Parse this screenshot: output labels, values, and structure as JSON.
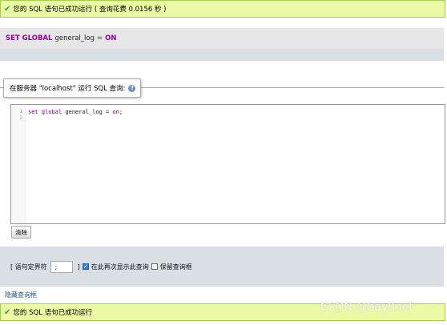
{
  "top_message": {
    "text": "您的 SQL 语句已成功运行 ( 查询花费 0.0156 秒 )",
    "icon": "check-icon"
  },
  "sql_display": {
    "keyword": "SET GLOBAL",
    "variable": "general_log",
    "operator": "=",
    "value": "ON"
  },
  "query_box": {
    "legend": "在服务器 \"localhost\" 运行 SQL 查询:",
    "line_numbers": [
      "1",
      "2"
    ],
    "code": {
      "kw1": "set",
      "kw2": "global",
      "var": "general_log",
      "op": "=",
      "val": "on",
      "end": ";"
    }
  },
  "clear_button": "清除",
  "options": {
    "delimiter_label": "[ 语句定界符",
    "delimiter_value": ";",
    "delimiter_close": "]",
    "show_again_label": "在此再次显示此查询",
    "show_again_checked": true,
    "keep_box_label": "保留查询框",
    "keep_box_checked": false
  },
  "hide_link": "隐藏查询框",
  "bottom_message": {
    "text": "您的 SQL 语句已成功运行",
    "icon": "check-icon"
  },
  "watermark": "CSDN @bay0net",
  "colors": {
    "success_bg": "#ebf8a4",
    "success_border": "#a2d246",
    "keyword": "#990099",
    "panel_bg": "#d9dfe5"
  }
}
